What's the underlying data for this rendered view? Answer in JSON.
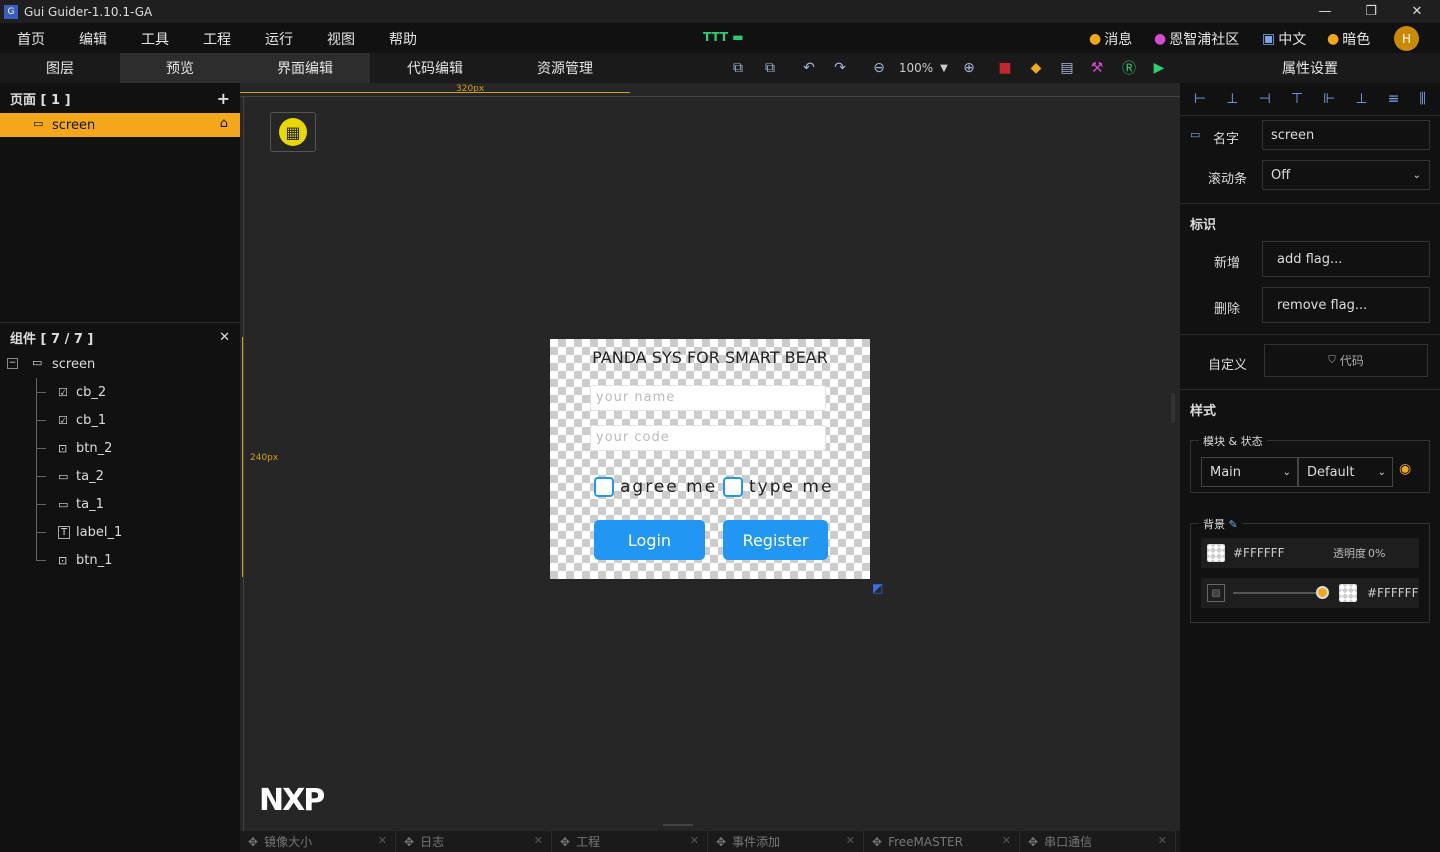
{
  "window": {
    "title": "Gui Guider-1.10.1-GA",
    "minimize": "—",
    "maximize": "❐",
    "close": "✕"
  },
  "menu": {
    "items": [
      "首页",
      "编辑",
      "工具",
      "工程",
      "运行",
      "视图",
      "帮助"
    ],
    "project": "TTT",
    "messages": "消息",
    "community": "恩智浦社区",
    "language": "中文",
    "theme": "暗色",
    "avatar": "H"
  },
  "left": {
    "tabs": [
      "图层",
      "预览"
    ],
    "pages_header": "页面 [ 1 ]",
    "screen_item": "screen",
    "components_header": "组件 [ 7 / 7 ]",
    "tree_root": "screen",
    "tree_children": [
      "cb_2",
      "cb_1",
      "btn_2",
      "ta_2",
      "ta_1",
      "label_1",
      "btn_1"
    ]
  },
  "center": {
    "tabs": [
      "界面编辑",
      "代码编辑",
      "资源管理"
    ],
    "zoom": "100%",
    "ruler_x_label": "320px",
    "ruler_y_label": "240px",
    "bottom_tabs": [
      "镜像大小",
      "日志",
      "工程",
      "事件添加",
      "FreeMASTER",
      "串口通信"
    ],
    "logo": "NXP"
  },
  "device": {
    "title": "PANDA SYS FOR SMART BEAR",
    "ta_name_placeholder": "your name",
    "ta_code_placeholder": "your code",
    "cb1_label": "agree me",
    "cb2_label": "type me",
    "btn_login": "Login",
    "btn_register": "Register"
  },
  "right": {
    "header": "属性设置",
    "name_label": "名字",
    "name_value": "screen",
    "scrollbar_label": "滚动条",
    "scrollbar_value": "Off",
    "flags_section": "标识",
    "add_label": "新增",
    "add_value": "add flag...",
    "remove_label": "删除",
    "remove_value": "remove flag...",
    "custom_label": "自定义",
    "custom_button": "代码",
    "style_section": "样式",
    "part_state_legend": "模块 & 状态",
    "part_value": "Main",
    "state_value": "Default",
    "bg_legend": "背景",
    "bg_color": "#FFFFFF",
    "opacity_label": "透明度",
    "opacity_value": "0%",
    "grad_color": "#FFFFFF"
  },
  "colors": {
    "accent": "#f3a81b",
    "button_blue": "#2196f3",
    "run_green": "#2ecc71"
  }
}
